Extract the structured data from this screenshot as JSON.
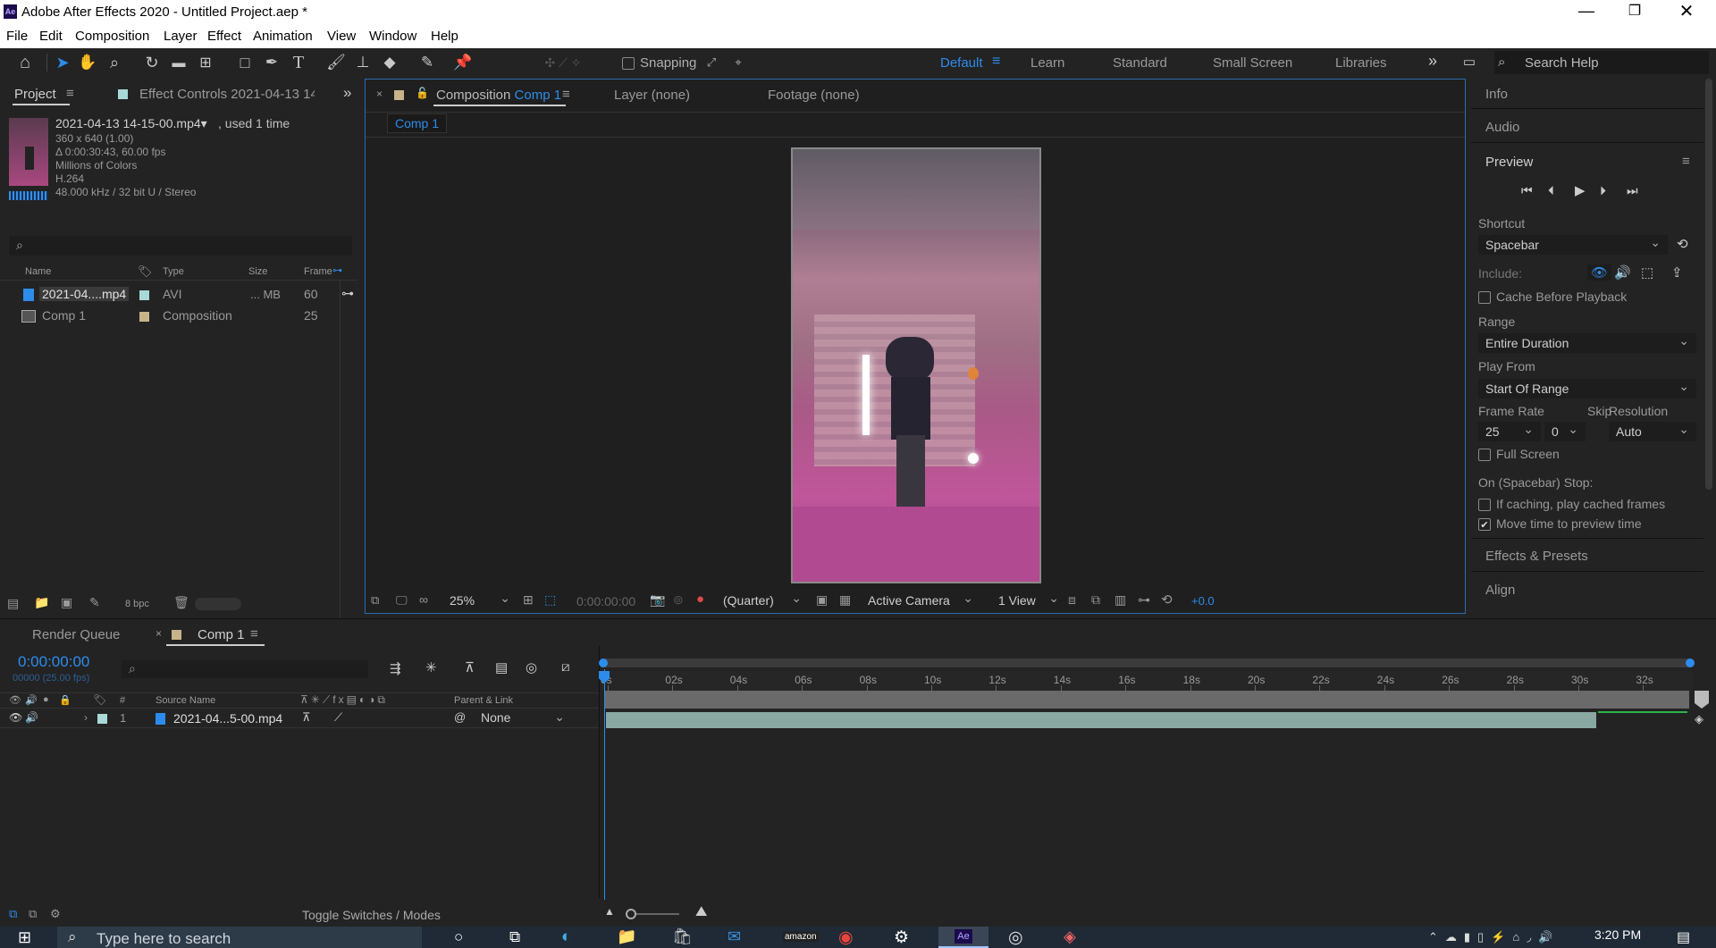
{
  "window": {
    "title": "Adobe After Effects 2020 - Untitled Project.aep *",
    "app_icon": "Ae"
  },
  "menu": [
    "File",
    "Edit",
    "Composition",
    "Layer",
    "Effect",
    "Animation",
    "View",
    "Window",
    "Help"
  ],
  "toolbar": {
    "snapping": "Snapping",
    "workspaces": [
      "Default",
      "Learn",
      "Standard",
      "Small Screen",
      "Libraries"
    ],
    "search_placeholder": "Search Help"
  },
  "project": {
    "tab": "Project",
    "effect_tab": "Effect Controls 2021-04-13 14-",
    "file": {
      "name": "2021-04-13 14-15-00.mp4▾",
      "used": ", used 1 time",
      "dims": "360 x 640 (1.00)",
      "duration": "Δ 0:00:30:43, 60.00 fps",
      "colors": "Millions of Colors",
      "codec": "H.264",
      "audio": "48.000 kHz / 32 bit U / Stereo"
    },
    "columns": [
      "Name",
      "Type",
      "Size",
      "Frame"
    ],
    "rows": [
      {
        "name": "2021-04....mp4",
        "type": "AVI",
        "size": "... MB",
        "frame": "60",
        "label_color": "#a8d9d6"
      },
      {
        "name": "Comp 1",
        "type": "Composition",
        "size": "",
        "frame": "25",
        "label_color": "#c8b38a"
      }
    ],
    "bpc": "8 bpc"
  },
  "viewer": {
    "tabs": {
      "comp_prefix": "Composition",
      "comp_name": "Comp 1",
      "layer": "Layer  (none)",
      "footage": "Footage  (none)"
    },
    "breadcrumb": "Comp 1",
    "zoom": "25%",
    "timecode": "0:00:00:00",
    "resolution": "(Quarter)",
    "camera": "Active Camera",
    "views": "1 View",
    "exposure": "+0.0"
  },
  "right": {
    "info": "Info",
    "audio": "Audio",
    "preview": "Preview",
    "shortcut_label": "Shortcut",
    "shortcut": "Spacebar",
    "include": "Include:",
    "cache": "Cache Before Playback",
    "range_label": "Range",
    "range": "Entire Duration",
    "play_from_label": "Play From",
    "play_from": "Start Of Range",
    "frame_rate_label": "Frame Rate",
    "skip_label": "Skip",
    "resolution_label": "Resolution",
    "frame_rate": "25",
    "skip": "0",
    "resolution": "Auto",
    "full_screen": "Full Screen",
    "stop_label": "On (Spacebar) Stop:",
    "if_caching": "If caching, play cached frames",
    "move_time": "Move time to preview time",
    "effects": "Effects & Presets",
    "align": "Align"
  },
  "timeline": {
    "render_queue": "Render Queue",
    "comp_tab": "Comp 1",
    "timecode": "0:00:00:00",
    "frames": "00000 (25.00 fps)",
    "headers": {
      "num": "#",
      "source": "Source Name",
      "parent": "Parent & Link"
    },
    "layer": {
      "num": "1",
      "name": "2021-04...5-00.mp4",
      "parent": "None"
    },
    "ruler": [
      "0s",
      "02s",
      "04s",
      "06s",
      "08s",
      "10s",
      "12s",
      "14s",
      "16s",
      "18s",
      "20s",
      "22s",
      "24s",
      "26s",
      "28s",
      "30s",
      "32s"
    ],
    "toggle": "Toggle Switches / Modes"
  },
  "taskbar": {
    "search": "Type here to search",
    "time": "3:20 PM",
    "amazon": "amazon"
  },
  "colors": {
    "accent": "#2d8ceb",
    "menu_bg": "#ffffff",
    "panel_bg": "#232323",
    "layer_bar": "#8aa8a2"
  }
}
